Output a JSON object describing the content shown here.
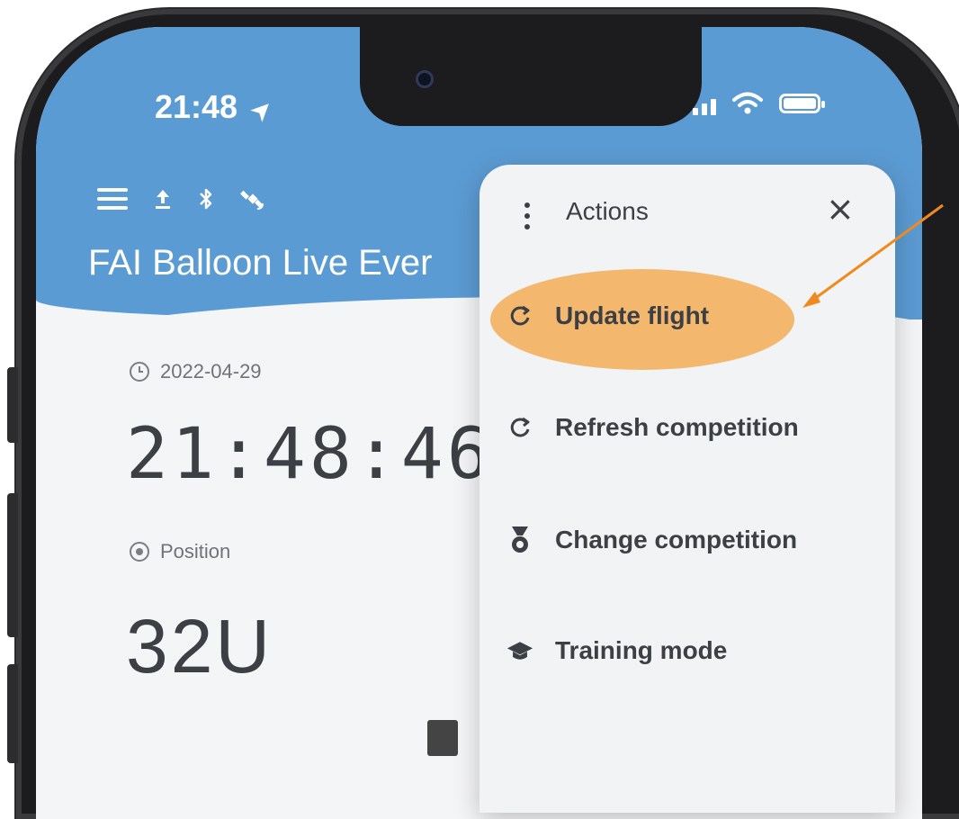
{
  "status_bar": {
    "time": "21:48",
    "location_arrow": "➤"
  },
  "toolbar": {
    "menu_icon": "hamburger-icon",
    "upload_icon": "upload-icon",
    "bluetooth_icon": "bluetooth-icon",
    "satellite_icon": "satellite-icon"
  },
  "app": {
    "title": "FAI Balloon Live Ever"
  },
  "main": {
    "date": "2022-04-29",
    "time": "21:48:46",
    "position_label": "Position",
    "position_value": "32U"
  },
  "actions_menu": {
    "title": "Actions",
    "close_label": "×",
    "items": [
      {
        "label": "Update flight",
        "icon": "refresh-icon",
        "highlighted": true
      },
      {
        "label": "Refresh competition",
        "icon": "refresh-icon"
      },
      {
        "label": "Change competition",
        "icon": "medal-icon"
      },
      {
        "label": "Training mode",
        "icon": "graduation-cap-icon"
      }
    ]
  },
  "colors": {
    "header_blue": "#5b9bd3",
    "highlight_orange": "#f2b466",
    "arrow_orange": "#f08a1e"
  }
}
